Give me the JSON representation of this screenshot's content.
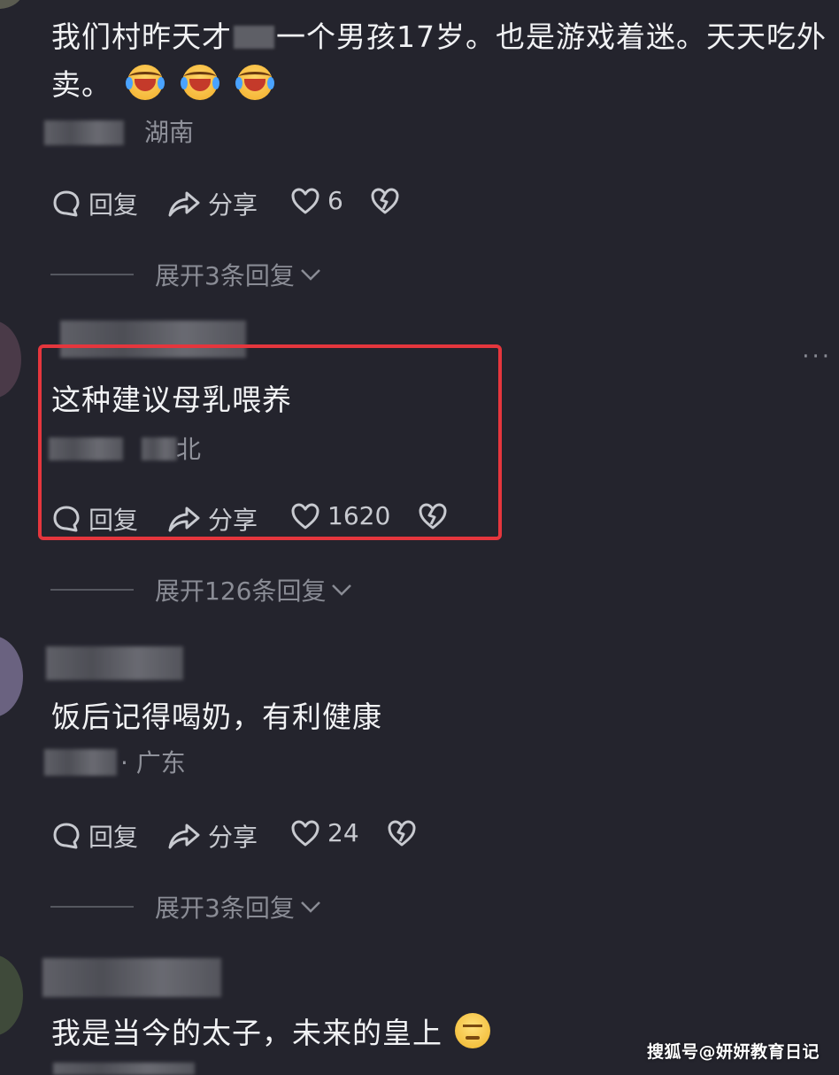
{
  "comments": [
    {
      "text": "我们村昨天才　一个男孩17岁。也是游戏着迷。天天吃外卖。",
      "line1": "我们村昨天才",
      "line1_after_blur": "一个男孩17岁。也是游戏着迷。天天吃外",
      "line2": "卖。",
      "emojis": [
        "laugh-cry-emoji",
        "laugh-cry-emoji",
        "laugh-cry-emoji"
      ],
      "location": "湖南",
      "actions": {
        "reply": "回复",
        "share": "分享",
        "likes": "6"
      },
      "expand": "展开3条回复"
    },
    {
      "text": "这种建议母乳喂养",
      "location": "北",
      "actions": {
        "reply": "回复",
        "share": "分享",
        "likes": "1620"
      },
      "expand": "展开126条回复"
    },
    {
      "text": "饭后记得喝奶，有利健康",
      "location": "· 广东",
      "actions": {
        "reply": "回复",
        "share": "分享",
        "likes": "24"
      },
      "expand": "展开3条回复"
    },
    {
      "text": "我是当今的太子，未来的皇上",
      "emojis": [
        "sulk-emoji"
      ]
    }
  ],
  "more_menu": "···",
  "watermark": "搜狐号@妍妍教育日记",
  "colors": {
    "background": "#24242d",
    "highlight": "#e5363d"
  }
}
